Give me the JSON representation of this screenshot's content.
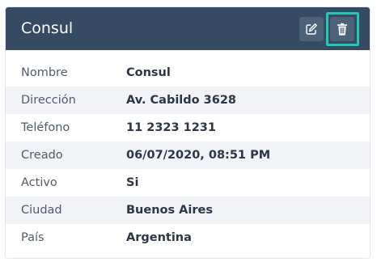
{
  "card": {
    "title": "Consul"
  },
  "icons": {
    "edit": "edit-icon",
    "delete": "trash-icon"
  },
  "details": [
    {
      "label": "Nombre",
      "value": "Consul"
    },
    {
      "label": "Dirección",
      "value": "Av. Cabildo 3628"
    },
    {
      "label": "Teléfono",
      "value": "11 2323 1231"
    },
    {
      "label": "Creado",
      "value": "06/07/2020, 08:51 PM"
    },
    {
      "label": "Activo",
      "value": "Si"
    },
    {
      "label": "Ciudad",
      "value": "Buenos Aires"
    },
    {
      "label": "País",
      "value": "Argentina"
    }
  ],
  "colors": {
    "header_bg": "#364a63",
    "highlight": "#1fc9b2",
    "row_alt": "#f1f3f6"
  }
}
